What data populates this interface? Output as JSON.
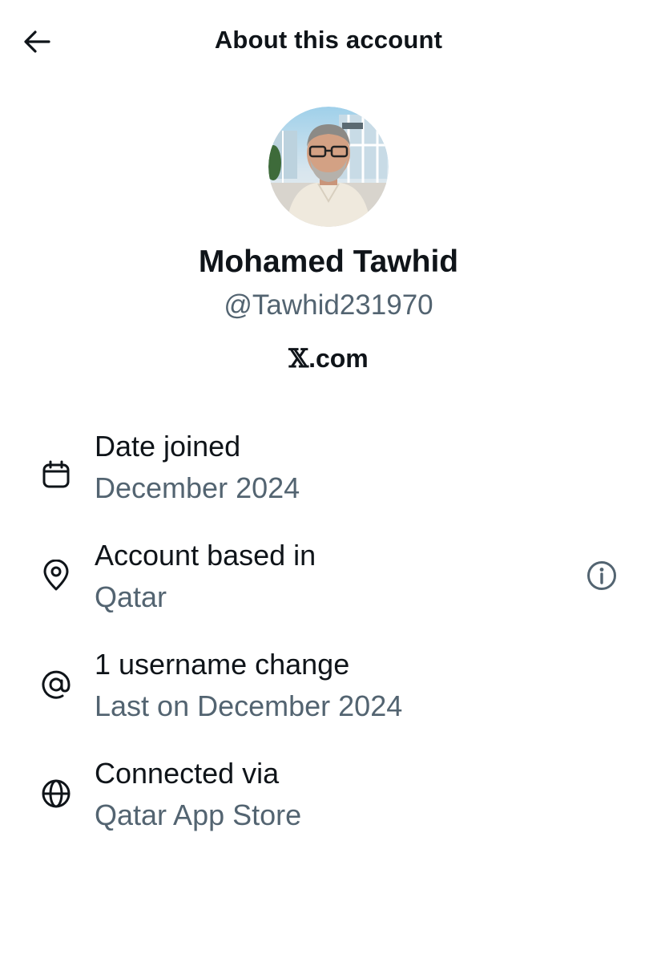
{
  "header": {
    "title": "About this account",
    "back_icon": "arrow-left-icon"
  },
  "profile": {
    "avatar_description_icon": "profile-photo",
    "display_name": "Mohamed Tawhid",
    "handle": "@Tawhid231970",
    "platform_mark": "𝕏",
    "platform_suffix": ".com"
  },
  "details": [
    {
      "icon": "calendar-icon",
      "title": "Date joined",
      "value": "December 2024"
    },
    {
      "icon": "location-pin-icon",
      "title": "Account based in",
      "value": "Qatar",
      "action_icon": "info-icon"
    },
    {
      "icon": "at-sign-icon",
      "title": "1 username change",
      "value": "Last on December 2024"
    },
    {
      "icon": "globe-icon",
      "title": "Connected via",
      "value": "Qatar App Store"
    }
  ],
  "colors": {
    "text_primary": "#0f1419",
    "text_secondary": "#536471",
    "background": "#ffffff"
  }
}
